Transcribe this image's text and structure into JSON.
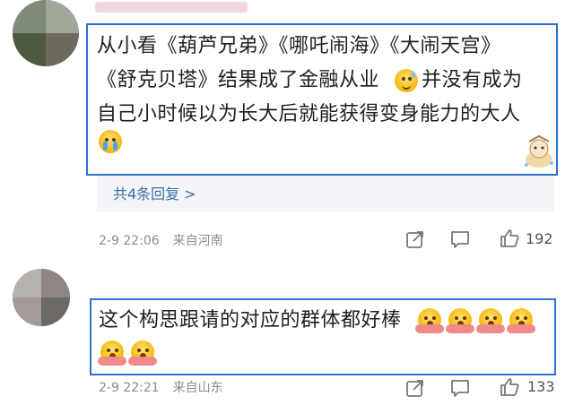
{
  "comments": [
    {
      "username": "",
      "text_lines": [
        "从小看《葫芦兄弟》《哪吒闹海》《大闹天宫》",
        "《舒克贝塔》结果成了金融从业",
        "并没有成为",
        "自己小时候以为长大后就能获得变身能力的大人"
      ],
      "emojis": [
        "smile-sweat-emoji",
        "crying-emoji"
      ],
      "reply_link": "共4条回复 >",
      "date": "2-9 22:06",
      "location": "来自河南",
      "like_count": "192"
    },
    {
      "username": "",
      "text_lines": [
        "这个构思跟请的对应的群体都好棒"
      ],
      "emojis": [
        "wow-emoji",
        "wow-emoji",
        "wow-emoji",
        "wow-emoji",
        "wow-emoji",
        "wow-emoji"
      ],
      "date": "2-9 22:21",
      "location": "来自山东",
      "like_count": "133"
    }
  ],
  "colors": {
    "highlight_box": "#2e6fd6",
    "reply_link": "#3b6ea8",
    "meta": "#8c8c8c"
  },
  "icons": [
    "share-icon",
    "comment-icon",
    "like-icon"
  ]
}
